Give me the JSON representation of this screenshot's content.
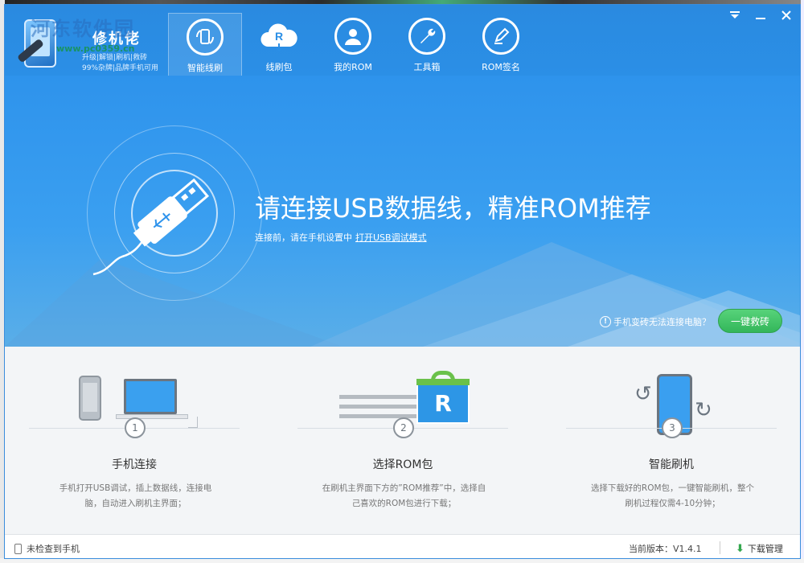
{
  "app": {
    "title": "修机佬",
    "tagline1": "升级|解锁|刷机|救砖",
    "tagline2": "99%杂牌|品牌手机可用",
    "watermark": "河东软件园",
    "watermark_url": "www.pc0359.cn"
  },
  "nav": [
    {
      "label": "智能线刷",
      "icon": "phone-refresh-icon",
      "active": true
    },
    {
      "label": "线刷包",
      "icon": "cloud-download-icon",
      "active": false
    },
    {
      "label": "我的ROM",
      "icon": "user-icon",
      "active": false
    },
    {
      "label": "工具箱",
      "icon": "wrench-icon",
      "active": false
    },
    {
      "label": "ROM签名",
      "icon": "pen-icon",
      "active": false
    }
  ],
  "hero": {
    "title": "请连接USB数据线，精准ROM推荐",
    "subtitle": "连接前，请在手机设置中",
    "link": "打开USB调试模式",
    "brick_question": "手机变砖无法连接电脑？",
    "brick_button": "一键救砖"
  },
  "steps": [
    {
      "num": "1",
      "title": "手机连接",
      "desc": "手机打开USB调试，插上数据线，连接电脑，自动进入刷机主界面；"
    },
    {
      "num": "2",
      "title": "选择ROM包",
      "desc": "在刷机主界面下方的”ROM推荐”中，选择自己喜欢的ROM包进行下载；"
    },
    {
      "num": "3",
      "title": "智能刷机",
      "desc": "选择下载好的ROM包，一键智能刷机，整个刷机过程仅需4-10分钟；"
    }
  ],
  "status": {
    "phone_status": "未检查到手机",
    "version": "当前版本：V1.4.1",
    "download": "下载管理"
  },
  "colors": {
    "header_blue": "#2a8ae0",
    "accent_green": "#33b65a"
  }
}
